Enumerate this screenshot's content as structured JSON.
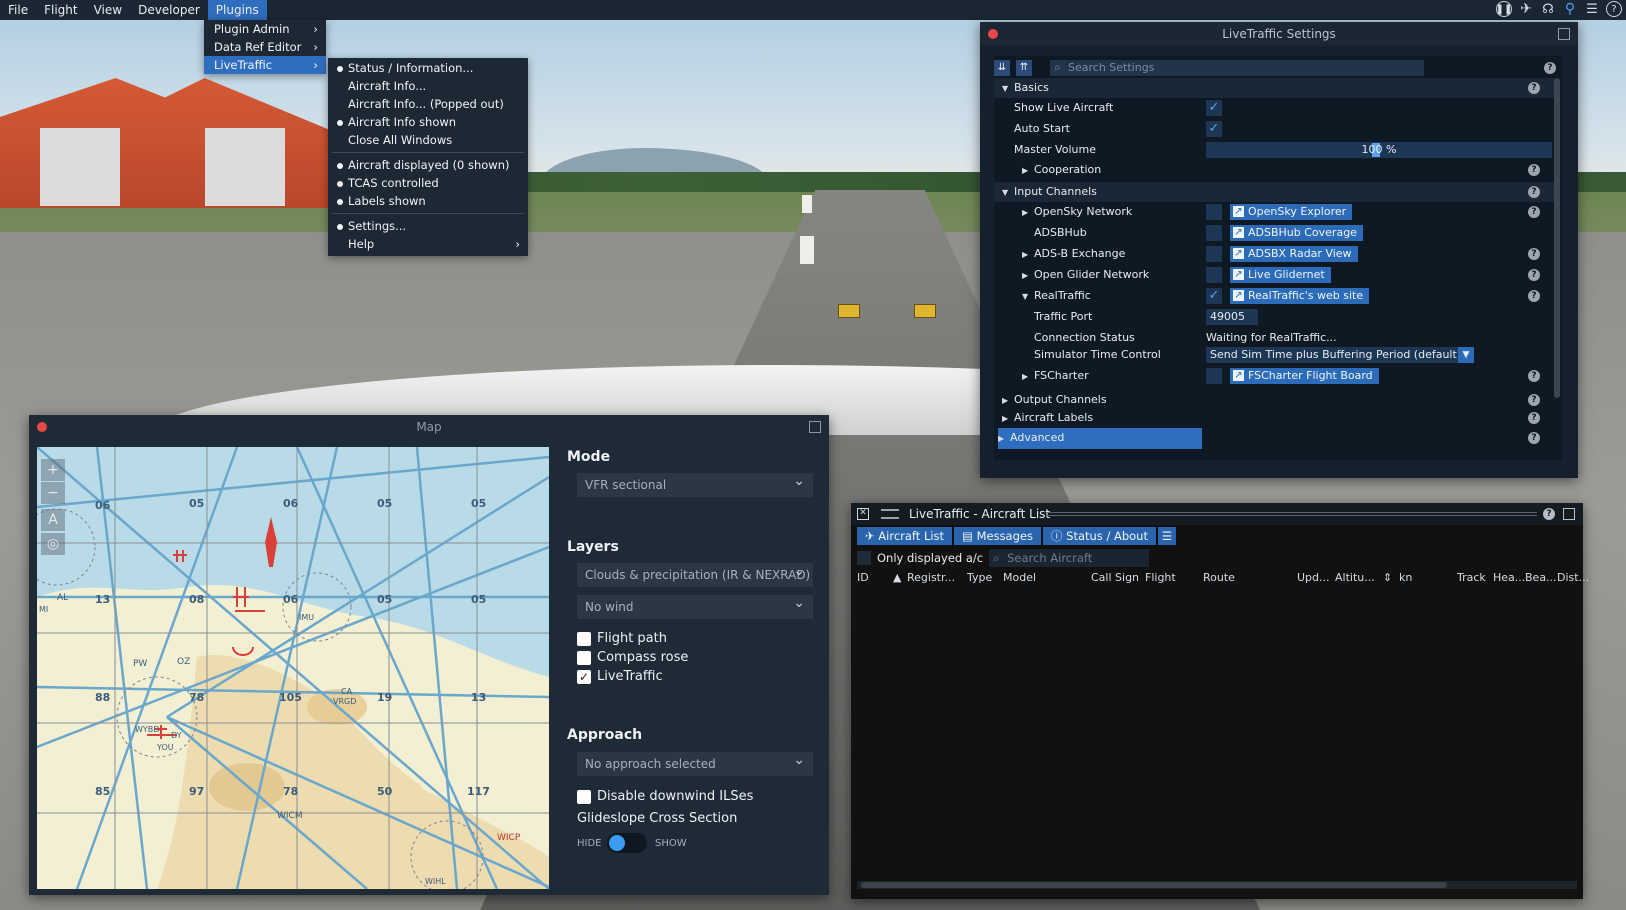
{
  "menubar": {
    "items": [
      "File",
      "Flight",
      "View",
      "Developer",
      "Plugins"
    ],
    "active_index": 4,
    "tray_icons": [
      "pause-icon",
      "aircraft-icon",
      "headset-icon",
      "location-icon",
      "sliders-icon",
      "help-icon"
    ]
  },
  "plugins_menu": {
    "items": [
      {
        "label": "Plugin Admin",
        "has_submenu": true
      },
      {
        "label": "Data Ref Editor",
        "has_submenu": true
      },
      {
        "label": "LiveTraffic",
        "has_submenu": true,
        "selected": true
      }
    ]
  },
  "livetraffic_menu": {
    "items": [
      {
        "label": "Status / Information...",
        "checked": true
      },
      {
        "label": "Aircraft Info...",
        "checked": false
      },
      {
        "label": "Aircraft Info... (Popped out)",
        "checked": false
      },
      {
        "label": "Aircraft Info shown",
        "checked": true
      },
      {
        "label": "Close All Windows",
        "checked": false
      },
      {
        "label": "Aircraft displayed (0 shown)",
        "checked": true
      },
      {
        "label": "TCAS controlled",
        "checked": true
      },
      {
        "label": "Labels shown",
        "checked": true
      },
      {
        "label": "Settings...",
        "checked": true
      },
      {
        "label": "Help",
        "checked": false,
        "has_submenu": true
      }
    ]
  },
  "settings": {
    "title": "LiveTraffic Settings",
    "search_placeholder": "Search Settings",
    "basics": "Basics",
    "show_live_aircraft": "Show Live Aircraft",
    "auto_start": "Auto Start",
    "master_volume": "Master Volume",
    "master_volume_value": "100 %",
    "cooperation": "Cooperation",
    "input_channels": "Input Channels",
    "opensky": "OpenSky Network",
    "opensky_btn": "OpenSky Explorer",
    "adsbhub": "ADSBHub",
    "adsbhub_btn": "ADSBHub Coverage",
    "adsbx": "ADS-B Exchange",
    "adsbx_btn": "ADSBX Radar View",
    "ogn": "Open Glider Network",
    "ogn_btn": "Live Glidernet",
    "realtraffic": "RealTraffic",
    "realtraffic_btn": "RealTraffic's web site",
    "traffic_port": "Traffic Port",
    "traffic_port_value": "49005",
    "connection_status": "Connection Status",
    "connection_status_value": "Waiting for RealTraffic...",
    "sim_time_control": "Simulator Time Control",
    "sim_time_control_value": "Send Sim Time plus Buffering Period (default)",
    "fscharter": "FSCharter",
    "fscharter_btn": "FSCharter Flight Board",
    "output_channels": "Output Channels",
    "aircraft_labels": "Aircraft Labels",
    "advanced": "Advanced"
  },
  "map": {
    "title": "Map",
    "mode_heading": "Mode",
    "mode_value": "VFR sectional",
    "layers_heading": "Layers",
    "layer_weather": "Clouds & precipitation (IR & NEXRAD)",
    "layer_wind": "No wind",
    "flight_path": "Flight path",
    "compass_rose": "Compass rose",
    "livetraffic": "LiveTraffic",
    "flight_path_checked": false,
    "compass_rose_checked": false,
    "livetraffic_checked": true,
    "approach_heading": "Approach",
    "approach_value": "No approach selected",
    "disable_ils": "Disable downwind ILSes",
    "disable_ils_checked": false,
    "glideslope": "Glideslope Cross Section",
    "hide": "HIDE",
    "show": "SHOW",
    "chart_labels": [
      "06",
      "05",
      "06",
      "05",
      "05",
      "13",
      "08",
      "06",
      "05",
      "05",
      "88",
      "78",
      "105",
      "19",
      "13",
      "85",
      "97",
      "78",
      "50",
      "117",
      "AL",
      "PW",
      "OZ",
      "IMU",
      "CA",
      "VRGD",
      "WYBD",
      "DY",
      "YOU",
      "WICM",
      "WICP",
      "WIHL",
      "MI"
    ]
  },
  "aircraft_list": {
    "title": "LiveTraffic - Aircraft List",
    "tabs": [
      "Aircraft List",
      "Messages",
      "Status / About"
    ],
    "only_displayed": "Only displayed a/c",
    "search_placeholder": "Search Aircraft",
    "columns": [
      "ID",
      "Registr...",
      "Type",
      "Model",
      "Call Sign",
      "Flight",
      "Route",
      "Upd...",
      "Altitu...",
      "kn",
      "Track",
      "Hea...",
      "Bea...",
      "Dist..."
    ]
  }
}
